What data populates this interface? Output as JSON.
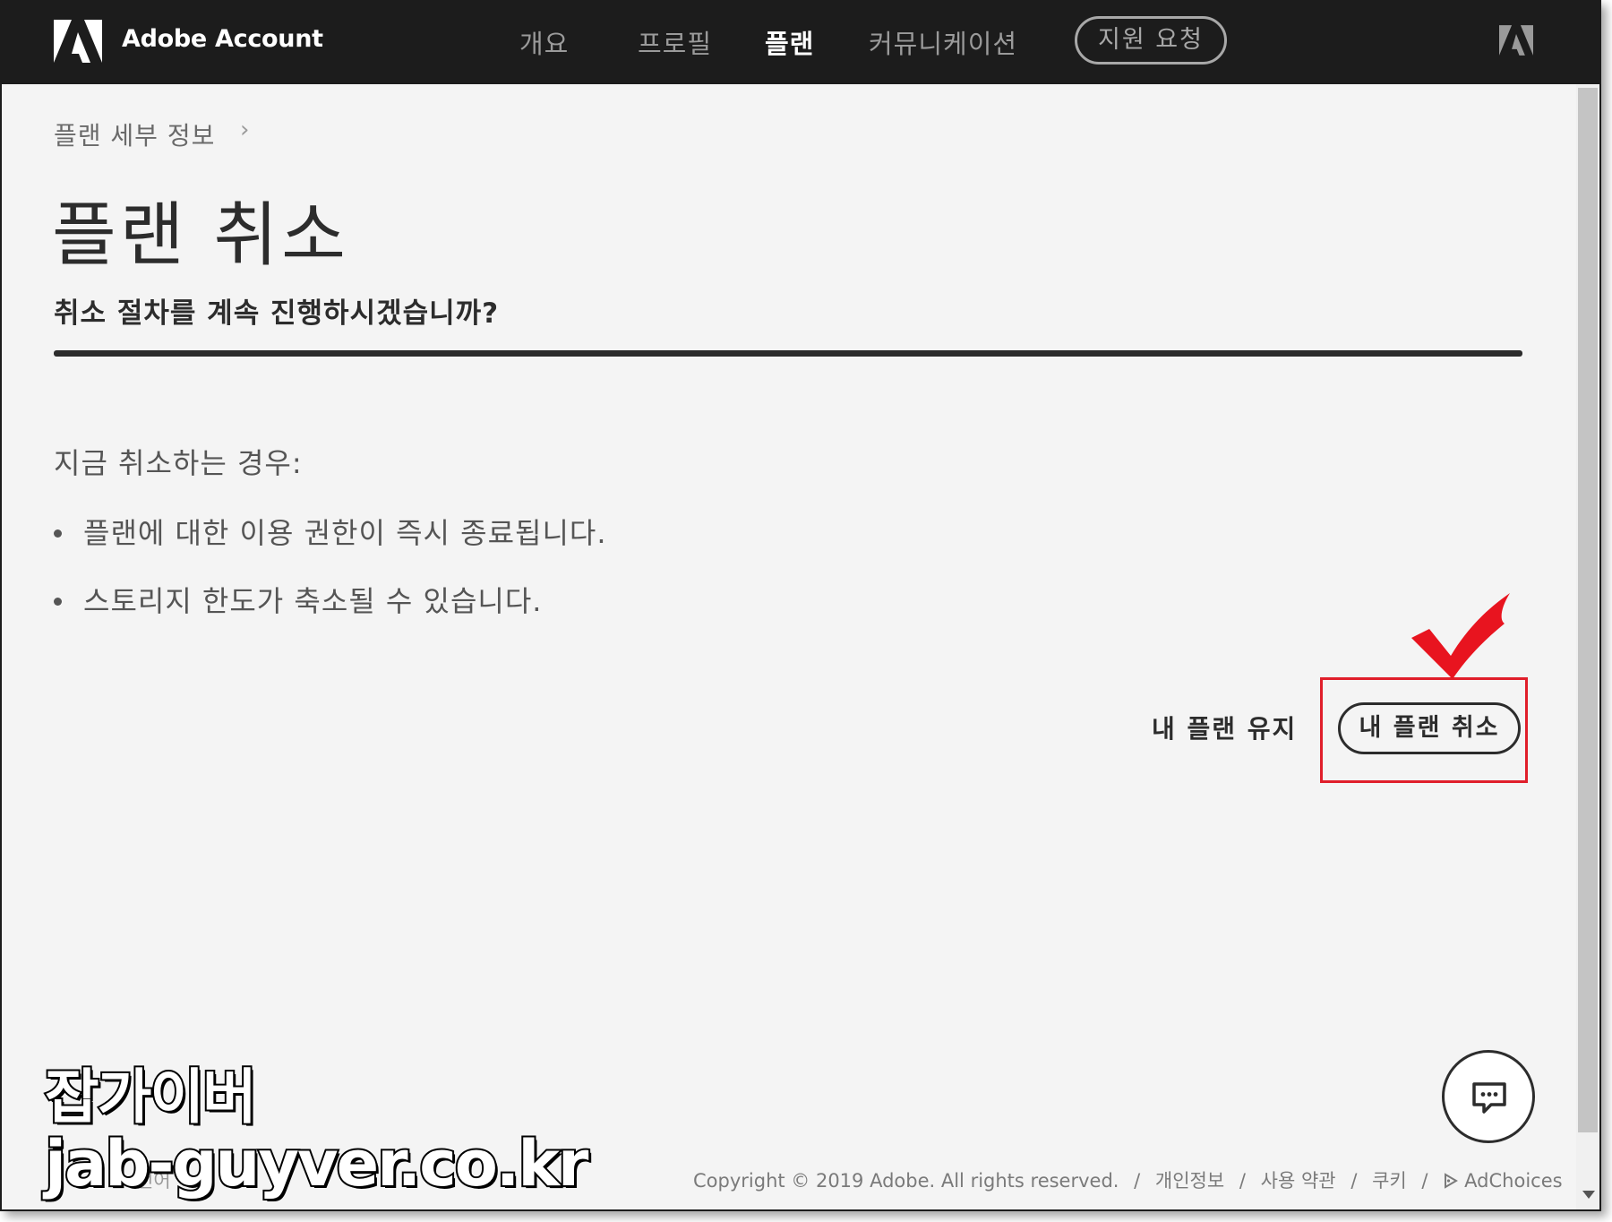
{
  "header": {
    "brand_name": "Adobe Account",
    "nav": [
      {
        "label": "개요",
        "active": false
      },
      {
        "label": "프로필",
        "active": false
      },
      {
        "label": "플랜",
        "active": true
      },
      {
        "label": "커뮤니케이션",
        "active": false
      }
    ],
    "support_button": "지원 요청",
    "brand_color": "#1c1c1c"
  },
  "content": {
    "breadcrumb": "플랜 세부 정보",
    "breadcrumb_separator": "›",
    "title": "플랜 취소",
    "subtitle": "취소 절차를 계속 진행하시겠습니까?",
    "intro": "지금 취소하는 경우:",
    "bullets": [
      "플랜에 대한 이용 권한이 즉시 종료됩니다.",
      "스토리지 한도가 축소될 수 있습니다."
    ],
    "keep_plan_label": "내 플랜 유지",
    "cancel_plan_label": "내 플랜 취소",
    "highlight_color": "#e01e2a"
  },
  "footer": {
    "left_text": "언어",
    "copyright": "Copyright © 2019 Adobe. All rights reserved.",
    "links": [
      "개인정보",
      "사용 약관",
      "쿠키",
      "AdChoices"
    ],
    "separator": "/"
  },
  "watermark": {
    "line1": "잡가이버",
    "line2": "jab-guyver.co.kr"
  },
  "icons": {
    "brand": "adobe-logo-icon",
    "corner": "adobe-logo-icon",
    "chat": "chat-bubble-icon",
    "adchoices": "adchoices-icon",
    "annotation": "red-checkmark-icon"
  }
}
